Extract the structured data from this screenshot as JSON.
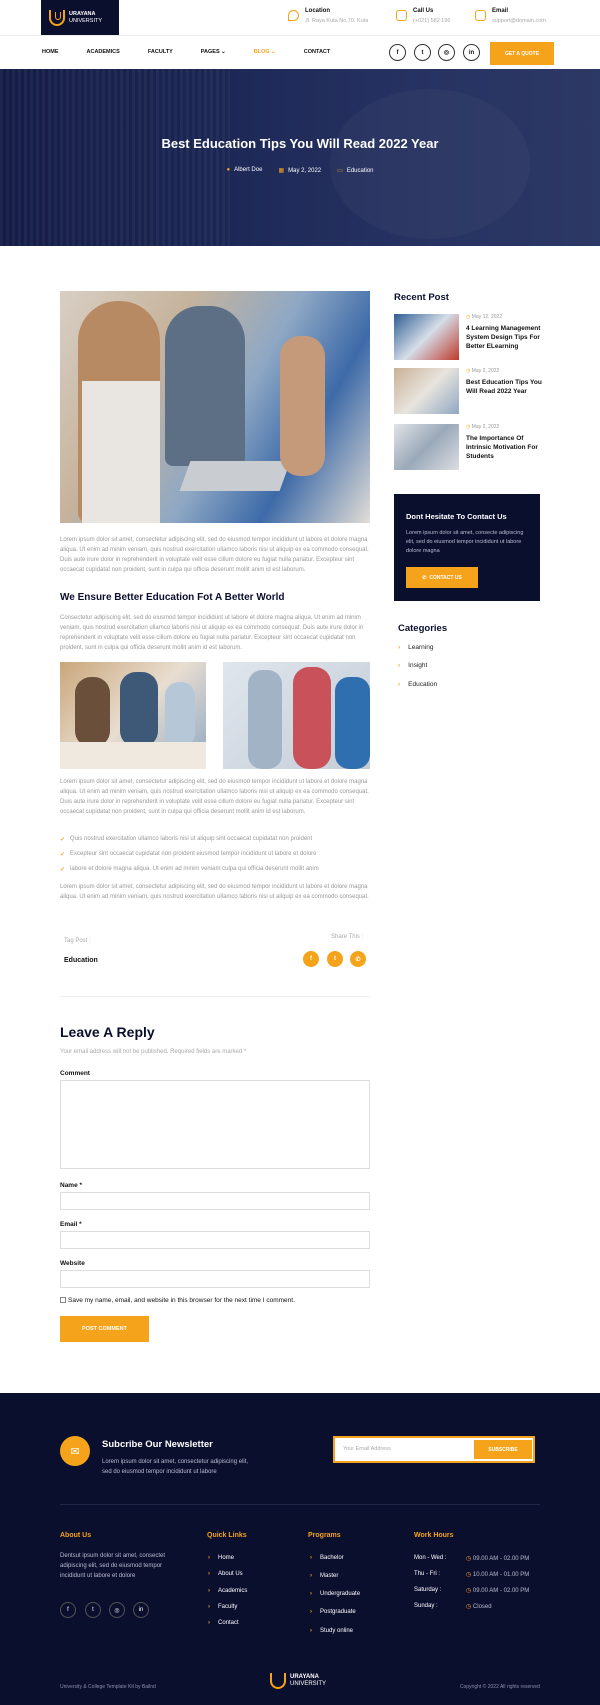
{
  "header": {
    "logo_top": "URAYANA",
    "logo_bottom": "UNIVERSITY",
    "location_label": "Location",
    "location_value": "Jl. Raya Kuta No.70, Kuta",
    "call_label": "Call Us",
    "call_value": "(+021) 582 196",
    "email_label": "Email",
    "email_value": "support@domain.com",
    "nav": [
      "HOME",
      "ACADEMICS",
      "FACULTY",
      "PAGES ⌄",
      "BLOG ⌄",
      "CONTACT"
    ],
    "active_nav": "BLOG ⌄",
    "socials": [
      "f",
      "t",
      "◎",
      "in"
    ],
    "quote_button": "GET A QUOTE"
  },
  "hero": {
    "title": "Best Education Tips You Will Read 2022 Year",
    "author": "Albert Doe",
    "date": "May 2, 2022",
    "category": "Education"
  },
  "article": {
    "para1": "Lorem ipsum dolor sit amet, consectetur adipiscing elit, sed do eiusmod tempor incididunt ut labore et dolore magna aliqua. Ut enim ad minim veniam, quis nostrud exercitation ullamco laboris nisi ut aliquip ex ea commodo consequat. Duis aute irure dolor in reprehenderit in voluptate velit esse cillum dolore eu fugiat nulla pariatur. Excepteur sint occaecat cupidatat non proident, sunt in culpa qui officia deserunt mollit anim id est laborum.",
    "heading": "We Ensure Better Education Fot A Better World",
    "para2": "Consectetur adipiscing elit, sed do eiusmod tempor incididunt ut labore et dolore magna aliqua. Ut enim ad minim veniam, quis nostrud exercitation ullamco laboris nisi ut aliquip ex ea commodo consequat. Duis aute irure dolor in reprehenderit in voluptate velit esse cillum dolore eu fugiat nulla pariatur. Excepteur sint occaecat cupidatat non proident, sunt in culpa qui officia deserunt mollit anim id est laborum.",
    "para3": "Lorem ipsum dolor sit amet, consectetur adipiscing elit, sed do eiusmod tempor incididunt ut labore et dolore magna aliqua. Ut enim ad minim veniam, quis nostrud exercitation ullamco laboris nisi ut aliquip ex ea commodo consequat. Duis aute irure dolor in reprehenderit in voluptate velit esse cillum dolore eu fugiat nulla pariatur. Excepteur sint occaecat cupidatat non proident, sunt in culpa qui officia deserunt mollit anim id est laborum.",
    "checks": [
      "Quis nostrud exercitation ullamco laboris nisi ut aliquip sint occaecat cupidatat non proident",
      "Excepteur sint occaecat cupidatat non proident eiusmod tempor incididunt ut labore et dolore",
      "labore et dolore magna aliqua. Ut enim ad minim veniam culpa qui officia deserunt mollit anim"
    ],
    "para4": "Lorem ipsum dolor sit amet, consectetur adipiscing elit, sed do eiusmod tempor incididunt ut labore et dolore magna aliqua. Ut enim ad minim veniam, quis nostrud exercitation ullamco laboris nisi ut aliquip ex ea commodo consequat.",
    "tag_label": "Tag Post :",
    "tag_value": "Education",
    "share_label": "Share This :"
  },
  "reply": {
    "title": "Leave A Reply",
    "note": "Your email address will not be published. Required fields are marked *",
    "comment_label": "Comment",
    "name_label": "Name *",
    "email_label": "Email *",
    "website_label": "Website",
    "save_label": "Save my name, email, and website in this browser for the next time I comment.",
    "submit": "POST COMMENT"
  },
  "sidebar": {
    "recent_title": "Recent Post",
    "posts": [
      {
        "date": "May 12, 2022",
        "title": "4 Learning Management System Design Tips For Better ELearning"
      },
      {
        "date": "May 2, 2022",
        "title": "Best Education Tips You Will Read 2022 Year"
      },
      {
        "date": "May 2, 2022",
        "title": "The Importance Of Intrinsic Motivation For Students"
      }
    ],
    "contact_title": "Dont Hesitate To Contact Us",
    "contact_text": "Lorem ipsum dolor sit amet, consecte adipiscing elit, sed do eiusmod tempor incididunt ut labore dolore magna",
    "contact_button": "CONTACT US",
    "categories_title": "Categories",
    "categories": [
      "Learning",
      "Insight",
      "Education"
    ]
  },
  "footer": {
    "newsletter_title": "Subcribe Our Newsletter",
    "newsletter_text": "Lorem ipsum dolor sit amet, consectetur adipiscing elit, sed do eiusmod tempor incididunt ut labore",
    "email_placeholder": "Your Email Address",
    "subscribe": "SUBSCRIBE",
    "about_title": "About Us",
    "about_text": "Dentsut ipsum dolor sit amet, consectet adipiscing elit, sed do eiusmod tempor incididunt ut labore et dolore",
    "quick_title": "Quick Links",
    "quick_links": [
      "Home",
      "About Us",
      "Academics",
      "Faculty",
      "Contact"
    ],
    "programs_title": "Programs",
    "programs": [
      "Bachelor",
      "Master",
      "Undergraduate",
      "Postgraduate",
      "Study online"
    ],
    "hours_title": "Work Hours",
    "hours": [
      {
        "day": "Mon - Wed :",
        "time": "09.00 AM - 02.00 PM"
      },
      {
        "day": "Thu - Fri :",
        "time": "10.00 AM - 01.00 PM"
      },
      {
        "day": "Saturday :",
        "time": "09.00 AM - 02.00 PM"
      },
      {
        "day": "Sunday :",
        "time": "Closed"
      }
    ],
    "credit": "University & College Template Kit by Bailnd",
    "copyright": "Copyright © 2022 All rights reserved"
  }
}
